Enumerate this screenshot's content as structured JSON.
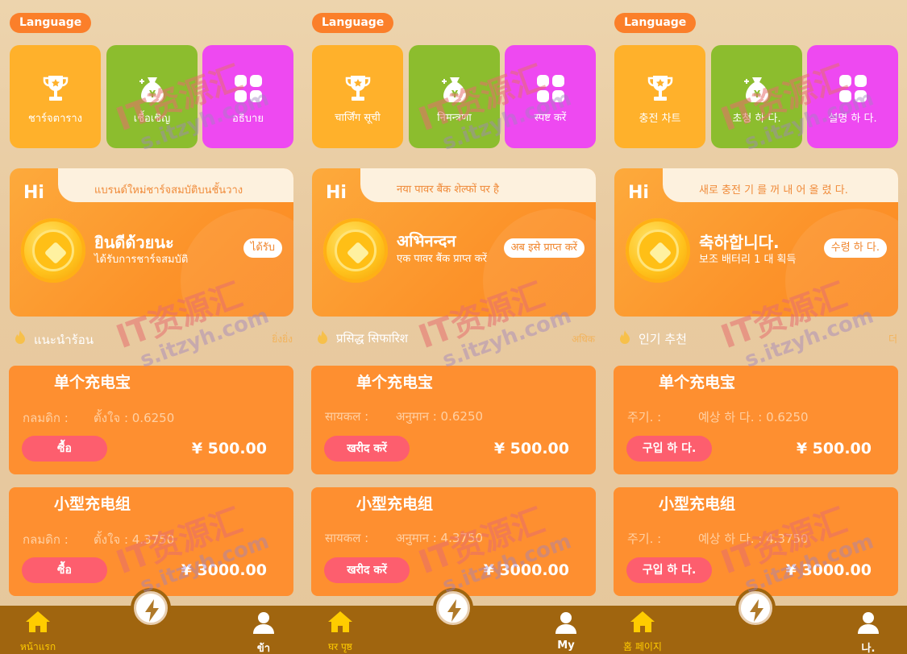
{
  "panels": [
    {
      "language": "Language",
      "tiles": [
        "ชาร์จตาราง",
        "เชื้อเชิญ",
        "อธิบาย"
      ],
      "hero": {
        "hi": "Hi",
        "notice": "แบรนด์ใหม่ชาร์จสมบัติบนชั้นวาง",
        "title": "ยินดีด้วยนะ",
        "subtitle": "ได้รับการชาร์จสมบัติ",
        "claim": "ได้รับ"
      },
      "recommend": {
        "title": "แนะนำร้อน",
        "more": "ยิ่งยิ่ง"
      },
      "products": [
        {
          "name": "单个充电宝",
          "cycle": "กลมดิก :",
          "yield": "ตั้งใจ : 0.6250",
          "buy": "ซื้อ",
          "price": "¥ 500.00"
        },
        {
          "name": "小型充电组",
          "cycle": "กลมดิก :",
          "yield": "ตั้งใจ : 4.3750",
          "buy": "ซื้อ",
          "price": "¥ 3000.00"
        }
      ],
      "nav": {
        "home": "หน้าแรก",
        "me": "ข้า"
      }
    },
    {
      "language": "Language",
      "tiles": [
        "चार्जिंग सूची",
        "निमन्त्रणा",
        "स्पष्ट करें"
      ],
      "hero": {
        "hi": "Hi",
        "notice": "नया पावर बैंक शेल्फों पर है",
        "title": "अभिनन्दन",
        "subtitle": "एक पावर बैंक प्राप्त करें",
        "claim": "अब इसे प्राप्त करें"
      },
      "recommend": {
        "title": "प्रसिद्ध सिफारिश",
        "more": "अधिक"
      },
      "products": [
        {
          "name": "单个充电宝",
          "cycle": "सायकल :",
          "yield": "अनुमान : 0.6250",
          "buy": "खरीद करें",
          "price": "¥ 500.00"
        },
        {
          "name": "小型充电组",
          "cycle": "सायकल :",
          "yield": "अनुमान : 4.3750",
          "buy": "खरीद करें",
          "price": "¥ 3000.00"
        }
      ],
      "nav": {
        "home": "घर पृष्ठ",
        "me": "My"
      }
    },
    {
      "language": "Language",
      "tiles": [
        "충전 차트",
        "초청 하 다.",
        "설명 하 다."
      ],
      "hero": {
        "hi": "Hi",
        "notice": "새로 충전 기 를 꺼 내 어 올 렸 다.",
        "title": "축하합니다.",
        "subtitle": "보조 배터리 1 대 획득",
        "claim": "수령 하 다."
      },
      "recommend": {
        "title": "인기 추천",
        "more": "더"
      },
      "products": [
        {
          "name": "单个充电宝",
          "cycle": "주기. :",
          "yield": "예상 하 다. : 0.6250",
          "buy": "구입 하 다.",
          "price": "¥ 500.00"
        },
        {
          "name": "小型充电组",
          "cycle": "주기. :",
          "yield": "예상 하 다. : 4.3750",
          "buy": "구입 하 다.",
          "price": "¥ 3000.00"
        }
      ],
      "nav": {
        "home": "홈 페이지",
        "me": "나."
      }
    }
  ],
  "watermark": {
    "text": "IT资源汇",
    "url": "s.itzyh.com"
  },
  "colors": {
    "background": "#e9cda4",
    "accent_orange": "#fb7f2a",
    "tile_yellow": "#ffb12b",
    "tile_green": "#8cbd2e",
    "tile_magenta": "#ee49f1",
    "card_orange": "#fe8f30",
    "buy_pink": "#fd5e6e",
    "nav_brown": "#a0650f",
    "nav_active": "#ffcc00"
  },
  "icons": [
    "trophy-icon",
    "money-bag-icon",
    "grid-icon",
    "coin-icon",
    "fire-icon",
    "home-icon",
    "lightning-icon",
    "user-icon"
  ]
}
